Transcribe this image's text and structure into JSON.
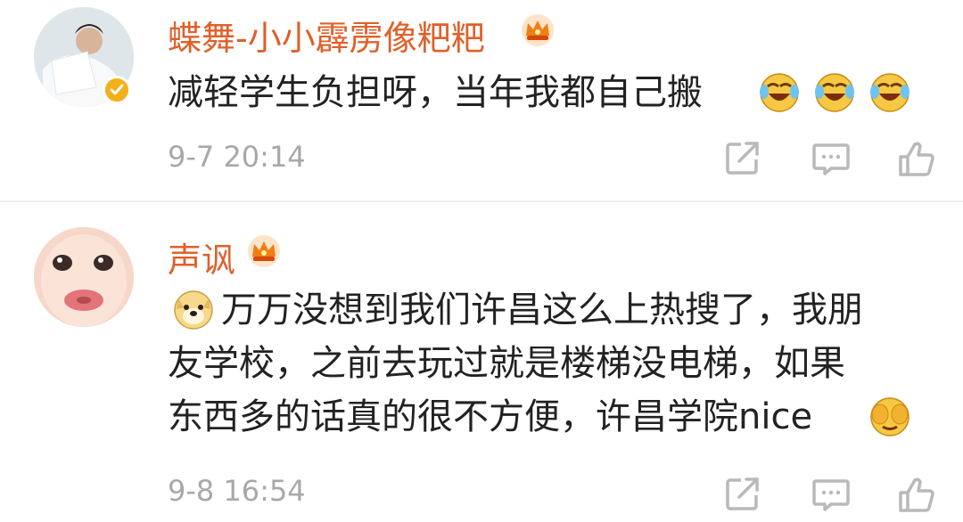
{
  "comments": [
    {
      "username": "蝶舞-小小霹雳像粑粑",
      "text": "减轻学生负担呀，当年我都自己搬",
      "time": "9-7 20:14",
      "avatar": "user-avatar-photo",
      "verified": true,
      "emojis": [
        "laugh-cry-emoji",
        "laugh-cry-emoji",
        "laugh-cry-emoji"
      ]
    },
    {
      "username": "声讽",
      "text_lines": [
        "万万没想到我们许昌这么上热搜了，我朋",
        "友学校，之前去玩过就是楼梯没电梯，如果",
        "东西多的话真的很不方便，许昌学院nice"
      ],
      "time": "9-8 16:54",
      "avatar": "user-avatar-photo",
      "verified": false,
      "emojis": [
        "doge-emoji",
        "cover-face-emoji"
      ]
    }
  ],
  "colors": {
    "username": "#e0602a",
    "text": "#222222",
    "meta": "#a8a8a8",
    "crown": "#f08a14",
    "badge": "#f4b018"
  },
  "actions": [
    "forward-icon",
    "comment-icon",
    "like-icon"
  ]
}
